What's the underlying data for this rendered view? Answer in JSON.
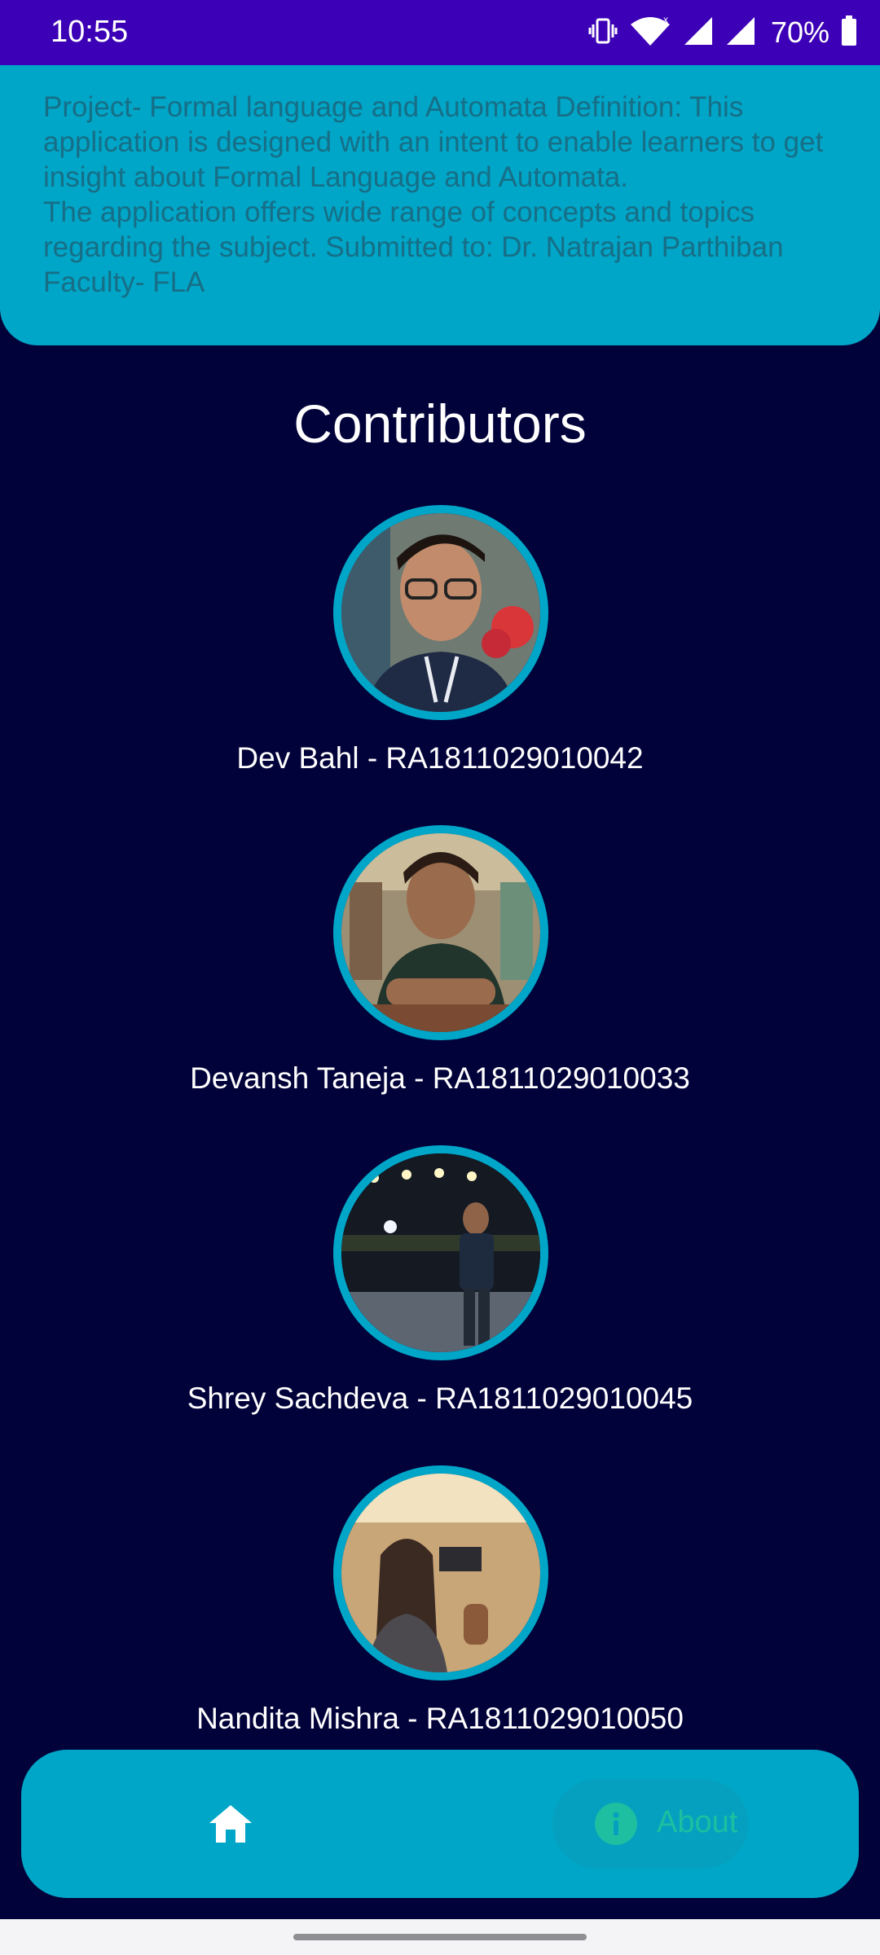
{
  "status_bar": {
    "time": "10:55",
    "battery_percent": "70%",
    "icons": [
      "vibrate-icon",
      "wifi-icon",
      "cell-signal-icon",
      "cell-signal-icon",
      "battery-icon"
    ]
  },
  "about_card": {
    "text": "Project- Formal language and Automata Definition: This application is designed with an intent to enable learners to get insight about Formal Language and Automata.\nThe application offers wide range of concepts and topics regarding the subject. Submitted to: Dr. Natrajan Parthiban Faculty- FLA"
  },
  "contributors": {
    "heading": "Contributors",
    "items": [
      {
        "name": "Dev Bahl - RA1811029010042"
      },
      {
        "name": "Devansh Taneja - RA1811029010033"
      },
      {
        "name": "Shrey Sachdeva - RA1811029010045"
      },
      {
        "name": "Nandita Mishra - RA1811029010050"
      }
    ]
  },
  "bottom_nav": {
    "home_icon": "home-icon",
    "about_icon": "info-icon",
    "about_label": "About"
  },
  "colors": {
    "status_bar": "#3c00b6",
    "background": "#02023a",
    "accent": "#00a6c8",
    "about_label": "#1dbfa0"
  }
}
